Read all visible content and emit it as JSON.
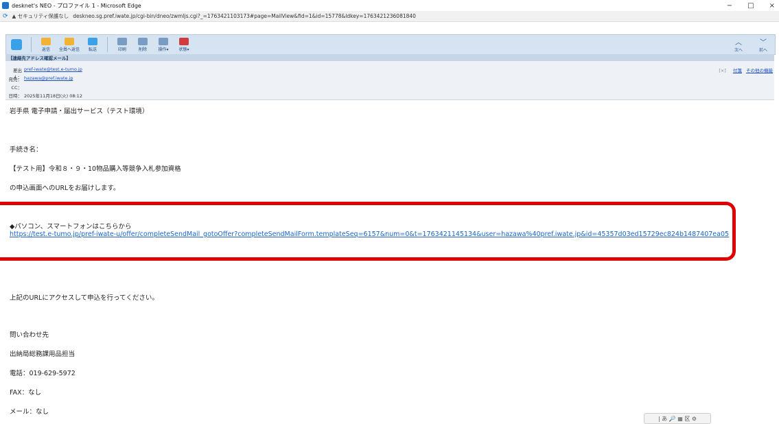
{
  "window": {
    "title": "desknet's NEO - プロファイル 1 - Microsoft Edge",
    "minimize": "−",
    "maximize": "□",
    "close": "×"
  },
  "addressbar": {
    "security": "▲ セキュリティ保護なし",
    "url": "deskneo.sg.pref.iwate.jp/cgi-bin/dneo/zwmljs.cgi?_=1763421103173#page=MailView&fid=1&id=15778&ldkey=1763421236081840"
  },
  "toolbar": {
    "buttons": [
      {
        "label": "返信",
        "color": "#f2b233"
      },
      {
        "label": "全員へ返信",
        "color": "#f2b233"
      },
      {
        "label": "転送",
        "color": "#3aa0e8"
      },
      {
        "label": "印刷",
        "color": "#7a9cc4"
      },
      {
        "label": "削除",
        "color": "#7a9cc4"
      },
      {
        "label": "操作▾",
        "color": "#7a9cc4"
      },
      {
        "label": "状態▾",
        "color": "#d23b3b"
      }
    ],
    "nav": [
      {
        "label": "次へ",
        "glyph": "︿"
      },
      {
        "label": "前へ",
        "glyph": "﹀"
      }
    ]
  },
  "mail": {
    "subject": "【連絡先アドレス確認メール】",
    "from_label": "差出人：",
    "from_value": "pref-iwate@test.e-tumo.jp",
    "to_label": "宛先：",
    "to_value": "hazawa@pref.iwate.jp",
    "cc_label": "CC：",
    "cc_value": "",
    "date_label": "日時：",
    "date_value": "2025年11月18日(火) 08:12",
    "header_right": {
      "close": "[×]",
      "sticky": "付箋",
      "other": "その他の機能"
    },
    "body": {
      "l1": "岩手県 電子申請・届出サービス（テスト環境）",
      "l2": "手続き名：",
      "l3": "【テスト用】令和８・９・10物品購入等競争入札参加資格",
      "l4": "の申込画面へのURLをお届けします。",
      "l5": "◆パソコン、スマートフォンはこちらから",
      "link": "https://test.e-tumo.jp/pref-iwate-u/offer/completeSendMail_gotoOffer?completeSendMailForm.templateSeq=6157&num=0&t=1763421145134&user=hazawa%40pref.iwate.jp&id=45357d03ed15729ec824b1487407ea05",
      "l6": "上記のURLにアクセスして申込を行ってください。",
      "l7": "問い合わせ先",
      "l8": "出納局総務課用品担当",
      "l9": "電話：019-629-5972",
      "l10": "FAX：なし",
      "l11": "メール：なし"
    }
  },
  "bottom_tools": "| あ 🔎 ▦ 区 ⚙"
}
